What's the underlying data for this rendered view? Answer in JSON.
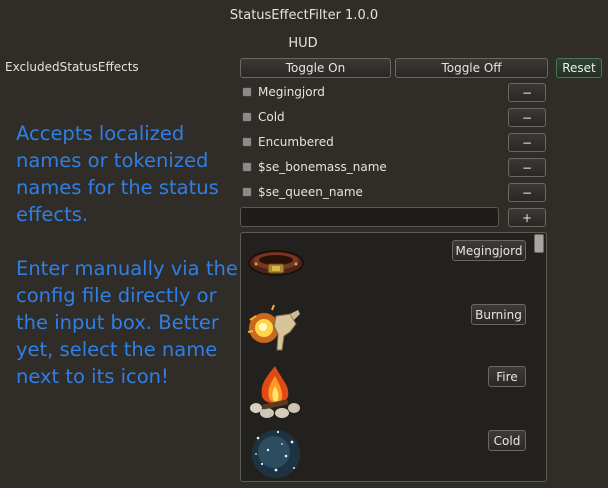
{
  "window": {
    "title": "StatusEffectFilter 1.0.0",
    "section": "HUD"
  },
  "setting": {
    "label": "ExcludedStatusEffects"
  },
  "toolbar": {
    "toggle_on": "Toggle On",
    "toggle_off": "Toggle Off",
    "reset": "Reset"
  },
  "entries": [
    {
      "name": "Megingjord",
      "remove": "−"
    },
    {
      "name": "Cold",
      "remove": "−"
    },
    {
      "name": "Encumbered",
      "remove": "−"
    },
    {
      "name": "$se_bonemass_name",
      "remove": "−"
    },
    {
      "name": "$se_queen_name",
      "remove": "−"
    }
  ],
  "add": {
    "input_value": "",
    "button": "+"
  },
  "icon_list": [
    {
      "label": "Megingjord",
      "icon": "megingjord-belt-icon"
    },
    {
      "label": "Burning",
      "icon": "burning-icon"
    },
    {
      "label": "Fire",
      "icon": "campfire-icon"
    },
    {
      "label": "Cold",
      "icon": "cold-frost-icon"
    }
  ],
  "annotation": {
    "paragraph1": "Accepts localized names or tokenized names for the status effects.",
    "paragraph2": "Enter manually via the config file directly or the input box. Better yet, select the name next to its icon!"
  },
  "colors": {
    "background": "#302d28",
    "annotation_text": "#2f7fe6",
    "reset_button": "#2f4233"
  }
}
